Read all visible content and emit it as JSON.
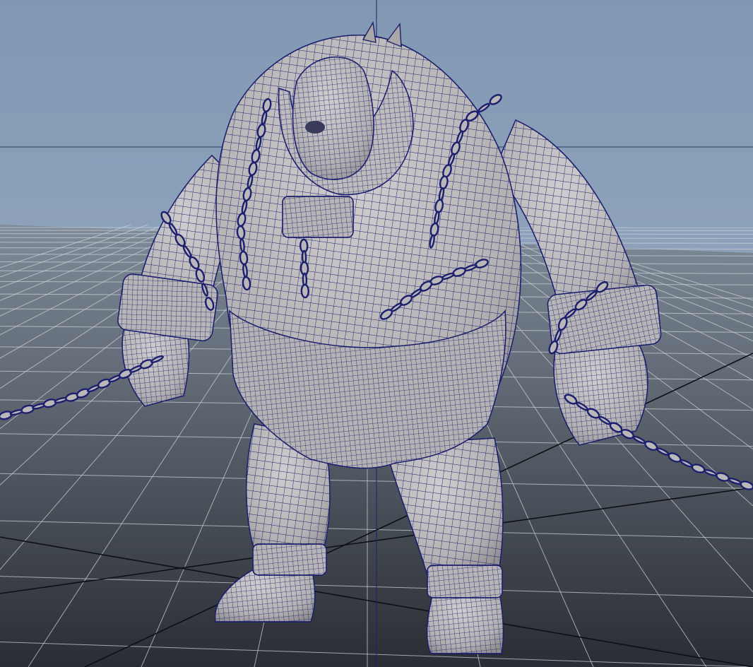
{
  "viewport": {
    "view": "perspective",
    "display_mode": "wireframe-on-shaded",
    "grid_visible": true
  },
  "colors": {
    "sky_top": "#8198b3",
    "sky_bottom": "#a2b3c6",
    "floor_near": "#2a2d33",
    "floor_far": "#7f8b99",
    "grid_line": "#c9ced4",
    "axis_line": "#0d0f12",
    "mesh_fill": "#b9b7b8",
    "mesh_shadow": "#8f8d8f",
    "wireframe": "#1c1f6e"
  },
  "model": {
    "name": "ogre-character",
    "props": [
      "chains",
      "shackles",
      "loincloth",
      "collar"
    ]
  }
}
